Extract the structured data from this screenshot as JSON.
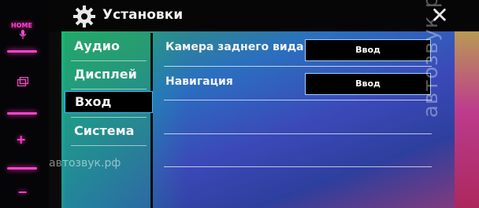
{
  "hardware": {
    "home_label": "HOME",
    "plus_label": "+",
    "minus_label": "−"
  },
  "header": {
    "title": "Установки",
    "close_label": "✕"
  },
  "menu": {
    "items": [
      {
        "label": "Аудио"
      },
      {
        "label": "Дисплей"
      },
      {
        "label": "Вход"
      },
      {
        "label": "Система"
      }
    ],
    "active": "Вход"
  },
  "settings": [
    {
      "label": "Камера заднего вида",
      "button": "Ввод"
    },
    {
      "label": "Навигация",
      "button": "Ввод"
    }
  ],
  "watermark": {
    "bottom": "автозвук.рф",
    "vertical": "автозвук.рф"
  },
  "colors": {
    "hardware_accent": "#ff45cc",
    "active_border": "#3ab6ff"
  }
}
